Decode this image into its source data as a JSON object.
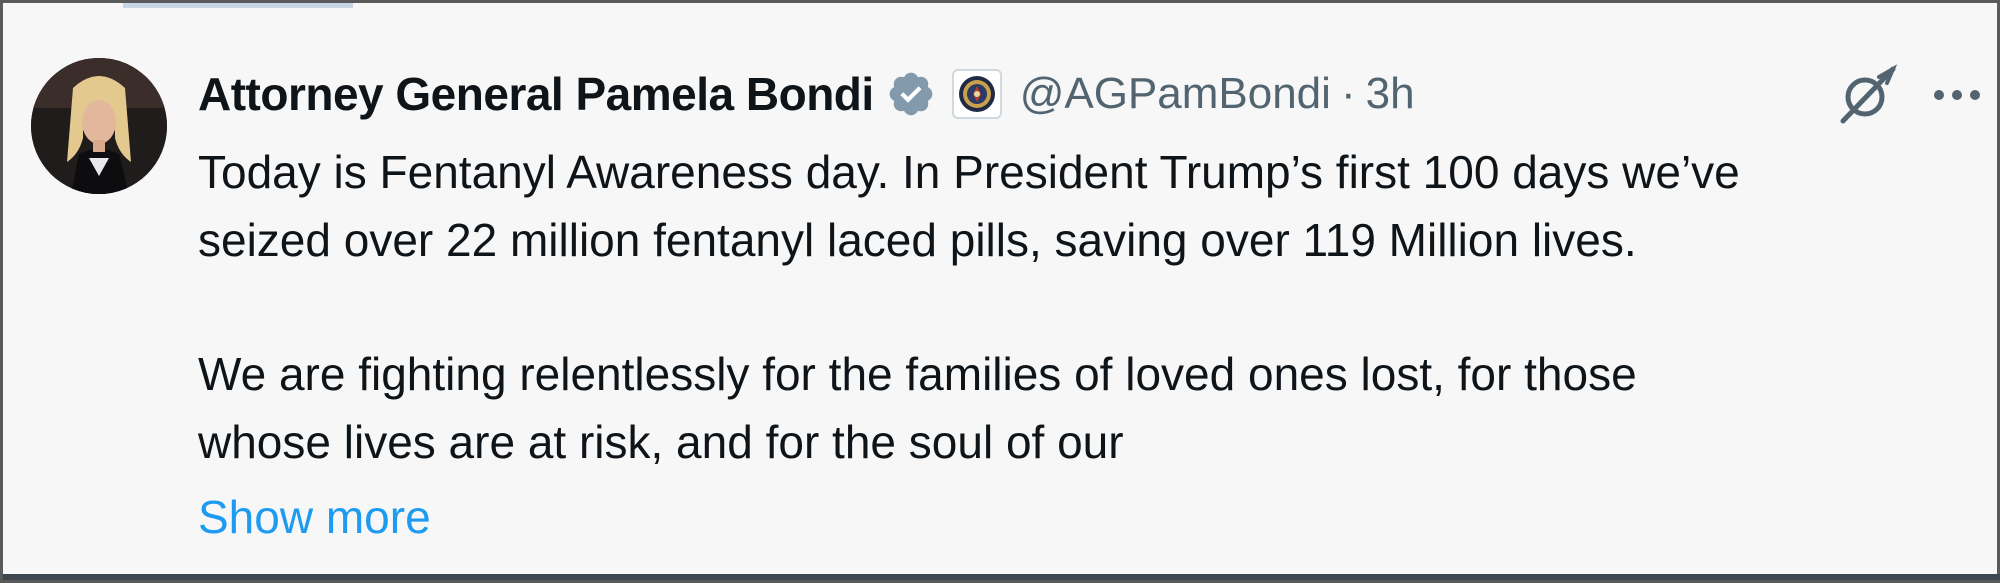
{
  "tweet": {
    "author": {
      "display_name": "Attorney General Pamela Bondi",
      "handle": "@AGPamBondi",
      "verified": true,
      "verified_color": "#829aab",
      "affiliate_badge": "doj-seal-icon"
    },
    "separator": "·",
    "timestamp": "3h",
    "text_lines": [
      "Today is Fentanyl Awareness day. In President Trump’s first 100 days we’ve",
      "seized over 22 million fentanyl laced pills, saving over 119 Million lives.",
      "",
      "We are fighting relentlessly for the families of loved ones lost, for those",
      "whose lives are at risk, and for the soul of our"
    ],
    "show_more_label": "Show more",
    "actions": {
      "grok_icon": "grok-icon",
      "more_icon": "more-options-icon"
    }
  },
  "colors": {
    "text_primary": "#0f1419",
    "text_secondary": "#536471",
    "link": "#1d9bf0",
    "background": "#f7f7f7"
  }
}
